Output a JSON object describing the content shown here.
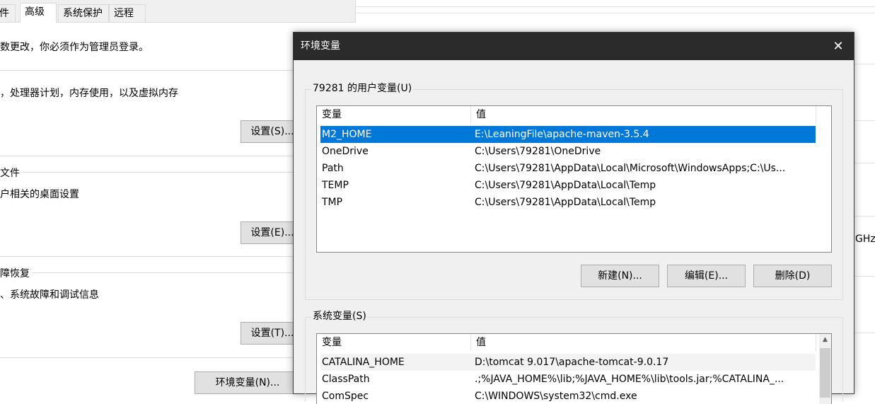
{
  "background": {
    "tabs": [
      "件",
      "高级",
      "系统保护",
      "远程"
    ],
    "admin_note": "数更改，你必须作为管理员登录。",
    "performance": {
      "desc": "，处理器计划，内存使用，以及虚拟内存",
      "settings_button": "设置(S)..."
    },
    "profile": {
      "title": "文件",
      "desc": "户相关的桌面设置",
      "settings_button": "设置(E)..."
    },
    "recovery": {
      "title": "障恢复",
      "desc": "、系统故障和调试信息",
      "settings_button": "设置(T)..."
    },
    "env_button": "环境变量(N)...",
    "right_edge_text": "GHz"
  },
  "dialog": {
    "title": "环境变量",
    "close_glyph": "✕",
    "user_vars": {
      "group_label": "79281 的用户变量(U)",
      "columns": [
        "变量",
        "值"
      ],
      "rows": [
        {
          "name": "M2_HOME",
          "value": "E:\\LeaningFile\\apache-maven-3.5.4"
        },
        {
          "name": "OneDrive",
          "value": "C:\\Users\\79281\\OneDrive"
        },
        {
          "name": "Path",
          "value": "C:\\Users\\79281\\AppData\\Local\\Microsoft\\WindowsApps;C:\\Us..."
        },
        {
          "name": "TEMP",
          "value": "C:\\Users\\79281\\AppData\\Local\\Temp"
        },
        {
          "name": "TMP",
          "value": "C:\\Users\\79281\\AppData\\Local\\Temp"
        }
      ],
      "selected_index": 0,
      "buttons": {
        "new": "新建(N)...",
        "edit": "编辑(E)...",
        "delete": "删除(D)"
      }
    },
    "system_vars": {
      "group_label": "系统变量(S)",
      "columns": [
        "变量",
        "值"
      ],
      "rows": [
        {
          "name": "CATALINA_HOME",
          "value": "D:\\tomcat 9.017\\apache-tomcat-9.0.17"
        },
        {
          "name": "ClassPath",
          "value": ".;%JAVA_HOME%\\lib;%JAVA_HOME%\\lib\\tools.jar;%CATALINA_..."
        },
        {
          "name": "ComSpec",
          "value": "C:\\WINDOWS\\system32\\cmd.exe"
        }
      ],
      "scroll_up_glyph": "▲"
    }
  },
  "colors": {
    "selection": "#0078d7",
    "titlebar": "#2b2b2b",
    "dialog_bg": "#f0f0f0"
  }
}
